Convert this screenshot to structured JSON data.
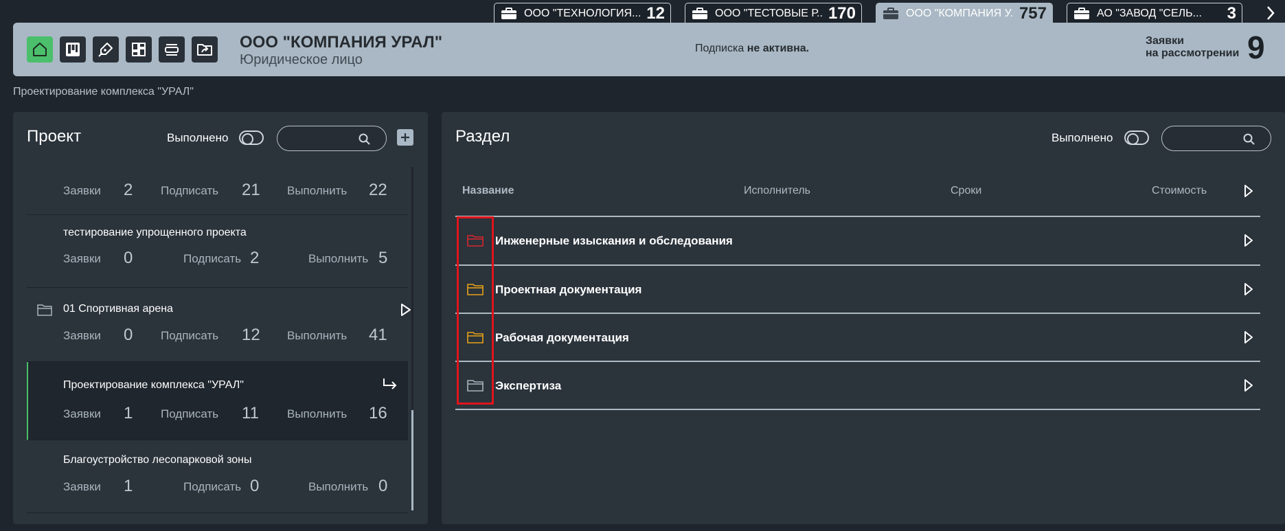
{
  "company_tabs": [
    {
      "name": "ООО \"ТЕХНОЛОГИЯ...",
      "count": "12"
    },
    {
      "name": "ООО \"ТЕСТОВЫЕ Р...",
      "count": "170"
    },
    {
      "name": "ООО \"КОМПАНИЯ У...",
      "count": "757",
      "active": true
    },
    {
      "name": "АО \"ЗАВОД \"СЕЛЬ...",
      "count": "3"
    }
  ],
  "header": {
    "org_name": "ООО \"КОМПАНИЯ УРАЛ\"",
    "org_type": "Юридическое лицо",
    "subscription_prefix": "Подписка",
    "subscription_status": "не активна.",
    "applications_label_1": "Заявки",
    "applications_label_2": "на рассмотрении",
    "applications_count": "9"
  },
  "breadcrumb": "Проектирование комплекса \"УРАЛ\"",
  "project_panel": {
    "title": "Проект",
    "done_label": "Выполнено",
    "search_value": "",
    "items": [
      {
        "name": "",
        "stats": [
          {
            "label": "Заявки",
            "value": "2"
          },
          {
            "label": "Подписать",
            "value": "21"
          },
          {
            "label": "Выполнить",
            "value": "22"
          }
        ]
      },
      {
        "name": "тестирование упрощенного проекта",
        "stats": [
          {
            "label": "Заявки",
            "value": "0"
          },
          {
            "label": "Подписать",
            "value": "2"
          },
          {
            "label": "Выполнить",
            "value": "5"
          }
        ]
      },
      {
        "name": "01 Спортивная арена",
        "stats": [
          {
            "label": "Заявки",
            "value": "0"
          },
          {
            "label": "Подписать",
            "value": "12"
          },
          {
            "label": "Выполнить",
            "value": "41"
          }
        ]
      },
      {
        "name": "Проектирование комплекса \"УРАЛ\"",
        "stats": [
          {
            "label": "Заявки",
            "value": "1"
          },
          {
            "label": "Подписать",
            "value": "11"
          },
          {
            "label": "Выполнить",
            "value": "16"
          }
        ]
      },
      {
        "name": "Благоустройство лесопарковой зоны",
        "stats": [
          {
            "label": "Заявки",
            "value": "1"
          },
          {
            "label": "Подписать",
            "value": "0"
          },
          {
            "label": "Выполнить",
            "value": "0"
          }
        ]
      }
    ]
  },
  "section_panel": {
    "title": "Раздел",
    "done_label": "Выполнено",
    "search_value": "",
    "columns": [
      "Название",
      "Исполнитель",
      "Сроки",
      "Стоимость"
    ],
    "rows": [
      {
        "name": "Инженерные изыскания и обследования",
        "folder_color": "#d9262c"
      },
      {
        "name": "Проектная документация",
        "folder_color": "#e8a317"
      },
      {
        "name": "Рабочая документация",
        "folder_color": "#e8a317"
      },
      {
        "name": "Экспертиза",
        "folder_color": "#aab5be"
      }
    ]
  },
  "colors": {
    "accent_green": "#4bbf6b",
    "highlight_red": "#e0141c",
    "header_bg": "#a9b8c4"
  }
}
